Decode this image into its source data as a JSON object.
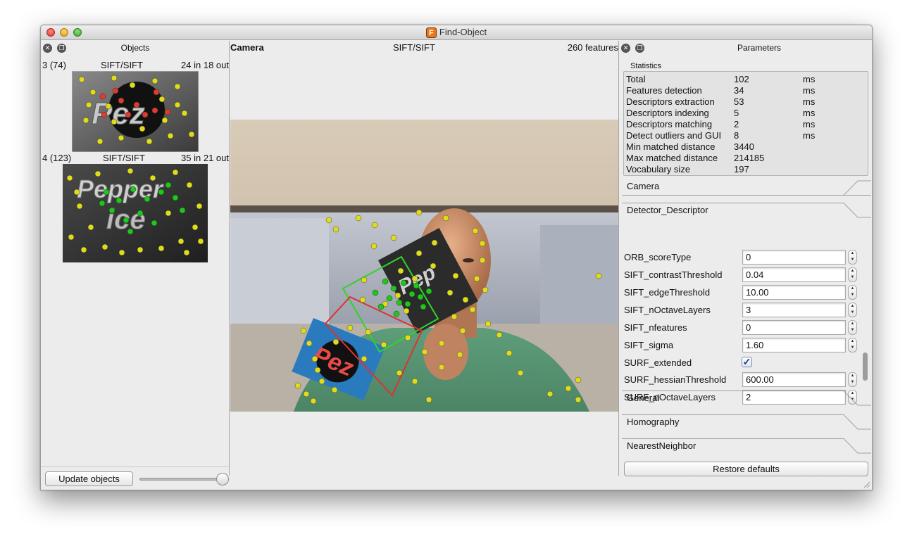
{
  "window": {
    "title": "Find-Object",
    "app_icon_letter": "F"
  },
  "objects_dock": {
    "title": "Objects",
    "items": [
      {
        "id_label": "3 (74)",
        "algo": "SIFT/SIFT",
        "inout": "24 in 18 out",
        "image": "object-3"
      },
      {
        "id_label": "4 (123)",
        "algo": "SIFT/SIFT",
        "inout": "35 in 21 out",
        "image": "object-4"
      }
    ],
    "update_button": "Update objects"
  },
  "camera": {
    "label": "Camera",
    "algo": "SIFT/SIFT",
    "features": "260 features"
  },
  "parameters_dock": {
    "title": "Parameters",
    "statistics": {
      "group_title": "Statistics",
      "rows": [
        {
          "name": "Total",
          "value": "102",
          "unit": "ms"
        },
        {
          "name": "Features detection",
          "value": "34",
          "unit": "ms"
        },
        {
          "name": "Descriptors extraction",
          "value": "53",
          "unit": "ms"
        },
        {
          "name": "Descriptors indexing",
          "value": "5",
          "unit": "ms"
        },
        {
          "name": "Descriptors matching",
          "value": "2",
          "unit": "ms"
        },
        {
          "name": "Detect outliers and GUI",
          "value": "8",
          "unit": "ms"
        },
        {
          "name": "Min matched distance",
          "value": "3440",
          "unit": ""
        },
        {
          "name": "Max matched distance",
          "value": "214185",
          "unit": ""
        },
        {
          "name": "Vocabulary size",
          "value": "197",
          "unit": ""
        }
      ]
    },
    "sections": {
      "camera": "Camera",
      "detector_descriptor": "Detector_Descriptor",
      "general": "General",
      "homography": "Homography",
      "nearest_neighbor": "NearestNeighbor"
    },
    "params": [
      {
        "name": "ORB_scoreType",
        "value": "0",
        "type": "spin"
      },
      {
        "name": "SIFT_contrastThreshold",
        "value": "0.04",
        "type": "spin"
      },
      {
        "name": "SIFT_edgeThreshold",
        "value": "10.00",
        "type": "spin"
      },
      {
        "name": "SIFT_nOctaveLayers",
        "value": "3",
        "type": "spin"
      },
      {
        "name": "SIFT_nfeatures",
        "value": "0",
        "type": "spin"
      },
      {
        "name": "SIFT_sigma",
        "value": "1.60",
        "type": "spin"
      },
      {
        "name": "SURF_extended",
        "value": "checked",
        "type": "checkbox"
      },
      {
        "name": "SURF_hessianThreshold",
        "value": "600.00",
        "type": "spin"
      },
      {
        "name": "SURF_nOctaveLayers",
        "value": "2",
        "type": "spin"
      }
    ],
    "restore_button": "Restore defaults"
  },
  "colors": {
    "inlier": "#22c51e",
    "outlier": "#e0dc1a",
    "unmatched": "#e23a2a",
    "homography_box_1": "#2fd42a",
    "homography_box_2": "#e03030"
  }
}
